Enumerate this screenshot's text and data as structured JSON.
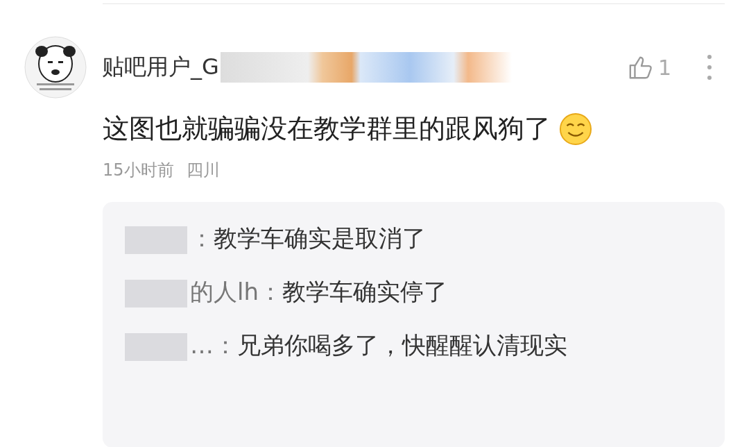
{
  "comment": {
    "author": "贴吧用户_G",
    "likes": "1",
    "text": "这图也就骗骗没在教学群里的跟风狗了",
    "time": "15小时前",
    "location": "四川"
  },
  "replies": [
    {
      "author": "：",
      "text": "教学车确实是取消了"
    },
    {
      "author": "的人lh：",
      "text": "教学车确实停了"
    },
    {
      "author": "…：",
      "text": "兄弟你喝多了，快醒醒认清现实"
    }
  ]
}
